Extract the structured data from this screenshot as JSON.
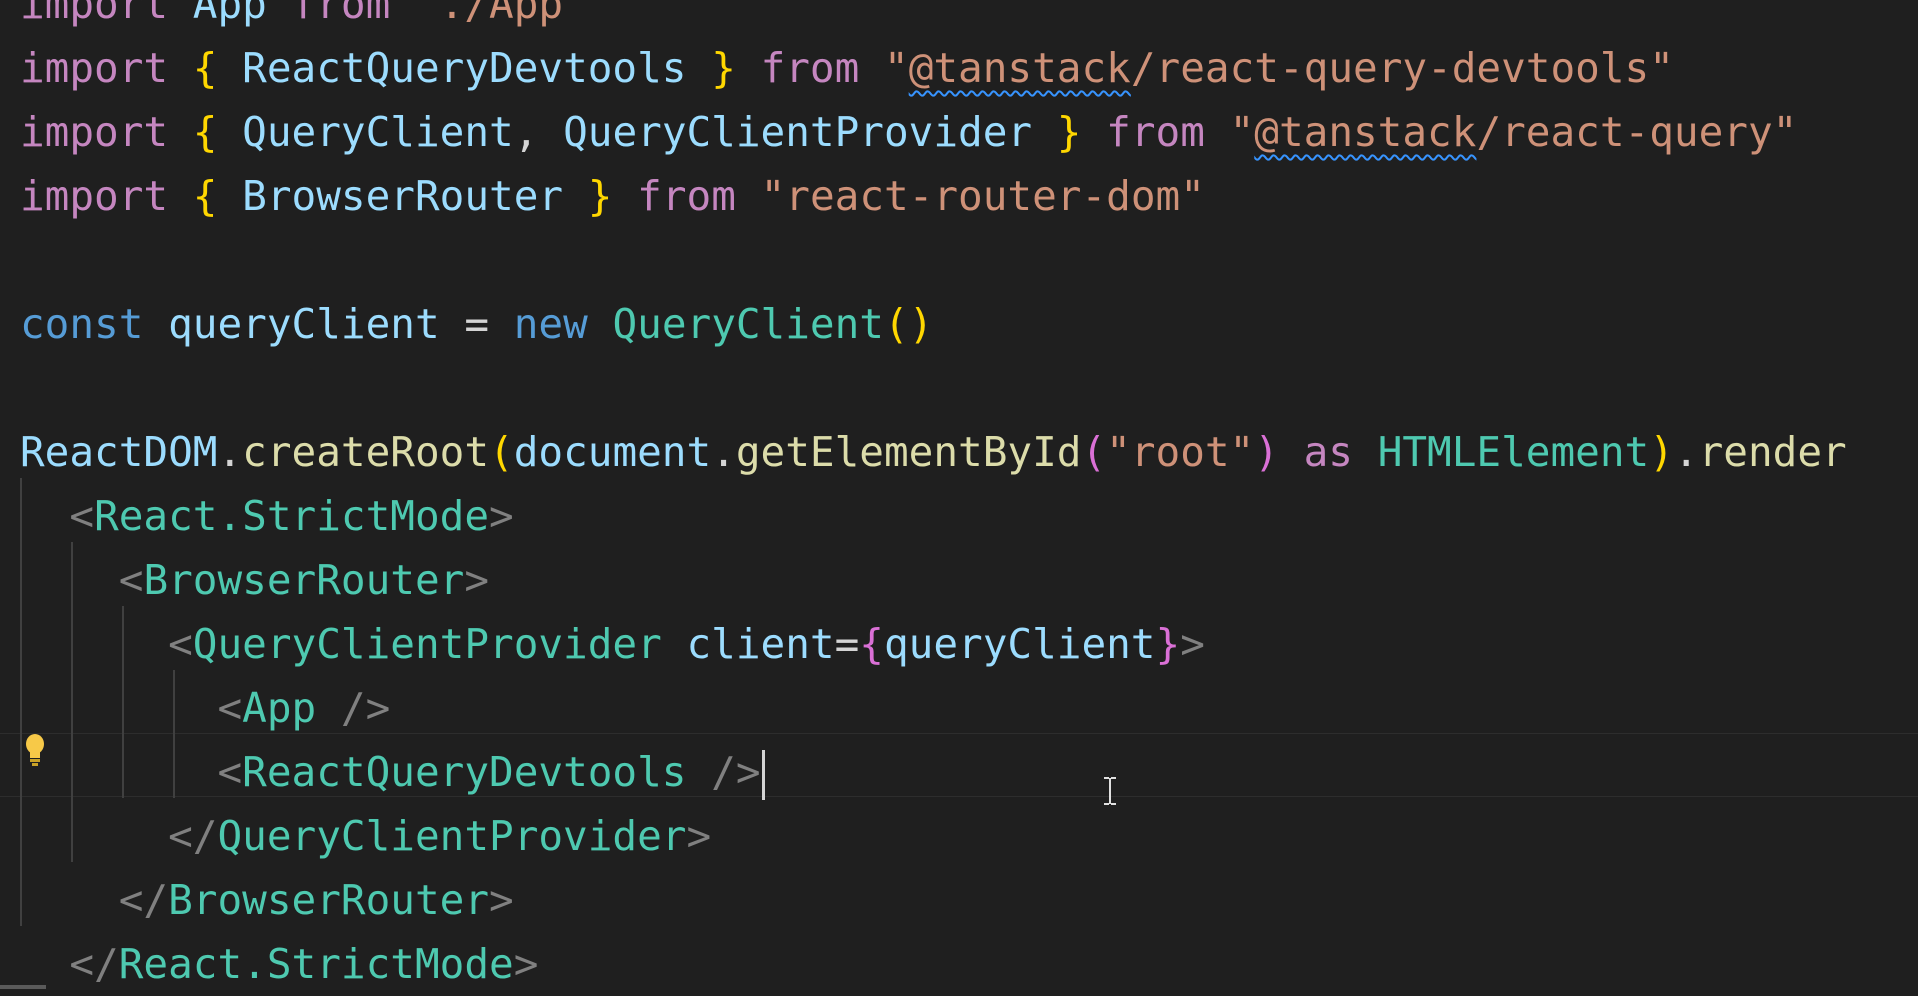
{
  "editor": {
    "language": "TypeScript React",
    "lines": [
      [
        {
          "t": "import",
          "c": "kw"
        },
        {
          "t": " ",
          "c": "pun"
        },
        {
          "t": "App",
          "c": "var"
        },
        {
          "t": " ",
          "c": "pun"
        },
        {
          "t": "from",
          "c": "kw"
        },
        {
          "t": " ",
          "c": "pun"
        },
        {
          "t": "\"./App\"",
          "c": "str"
        }
      ],
      [
        {
          "t": "import",
          "c": "kw"
        },
        {
          "t": " ",
          "c": "pun"
        },
        {
          "t": "{",
          "c": "br"
        },
        {
          "t": " ",
          "c": "pun"
        },
        {
          "t": "ReactQueryDevtools",
          "c": "var"
        },
        {
          "t": " ",
          "c": "pun"
        },
        {
          "t": "}",
          "c": "br"
        },
        {
          "t": " ",
          "c": "pun"
        },
        {
          "t": "from",
          "c": "kw"
        },
        {
          "t": " ",
          "c": "pun"
        },
        {
          "t": "\"",
          "c": "str"
        },
        {
          "t": "@tanstack",
          "c": "str squig"
        },
        {
          "t": "/react-query-devtools\"",
          "c": "str"
        }
      ],
      [
        {
          "t": "import",
          "c": "kw"
        },
        {
          "t": " ",
          "c": "pun"
        },
        {
          "t": "{",
          "c": "br"
        },
        {
          "t": " ",
          "c": "pun"
        },
        {
          "t": "QueryClient",
          "c": "var"
        },
        {
          "t": ", ",
          "c": "pun"
        },
        {
          "t": "QueryClientProvider",
          "c": "var"
        },
        {
          "t": " ",
          "c": "pun"
        },
        {
          "t": "}",
          "c": "br"
        },
        {
          "t": " ",
          "c": "pun"
        },
        {
          "t": "from",
          "c": "kw"
        },
        {
          "t": " ",
          "c": "pun"
        },
        {
          "t": "\"",
          "c": "str"
        },
        {
          "t": "@tanstack",
          "c": "str squig"
        },
        {
          "t": "/react-query\"",
          "c": "str"
        }
      ],
      [
        {
          "t": "import",
          "c": "kw"
        },
        {
          "t": " ",
          "c": "pun"
        },
        {
          "t": "{",
          "c": "br"
        },
        {
          "t": " ",
          "c": "pun"
        },
        {
          "t": "BrowserRouter",
          "c": "var"
        },
        {
          "t": " ",
          "c": "pun"
        },
        {
          "t": "}",
          "c": "br"
        },
        {
          "t": " ",
          "c": "pun"
        },
        {
          "t": "from",
          "c": "kw"
        },
        {
          "t": " ",
          "c": "pun"
        },
        {
          "t": "\"react-router-dom\"",
          "c": "str"
        }
      ],
      [],
      [
        {
          "t": "const",
          "c": "st"
        },
        {
          "t": " ",
          "c": "pun"
        },
        {
          "t": "queryClient",
          "c": "var"
        },
        {
          "t": " = ",
          "c": "pun"
        },
        {
          "t": "new",
          "c": "st"
        },
        {
          "t": " ",
          "c": "pun"
        },
        {
          "t": "QueryClient",
          "c": "ty"
        },
        {
          "t": "()",
          "c": "br"
        }
      ],
      [],
      [
        {
          "t": "ReactDOM",
          "c": "var"
        },
        {
          "t": ".",
          "c": "pun"
        },
        {
          "t": "createRoot",
          "c": "fn"
        },
        {
          "t": "(",
          "c": "br"
        },
        {
          "t": "document",
          "c": "var"
        },
        {
          "t": ".",
          "c": "pun"
        },
        {
          "t": "getElementById",
          "c": "fn"
        },
        {
          "t": "(",
          "c": "br2"
        },
        {
          "t": "\"root\"",
          "c": "str"
        },
        {
          "t": ")",
          "c": "br2"
        },
        {
          "t": " ",
          "c": "pun"
        },
        {
          "t": "as",
          "c": "kw"
        },
        {
          "t": " ",
          "c": "pun"
        },
        {
          "t": "HTMLElement",
          "c": "ty"
        },
        {
          "t": ")",
          "c": "br"
        },
        {
          "t": ".",
          "c": "pun"
        },
        {
          "t": "render",
          "c": "fn"
        }
      ],
      [
        {
          "t": "  ",
          "c": "pun"
        },
        {
          "t": "<",
          "c": "tag"
        },
        {
          "t": "React.StrictMode",
          "c": "jsx"
        },
        {
          "t": ">",
          "c": "tag"
        }
      ],
      [
        {
          "t": "    ",
          "c": "pun"
        },
        {
          "t": "<",
          "c": "tag"
        },
        {
          "t": "BrowserRouter",
          "c": "jsx"
        },
        {
          "t": ">",
          "c": "tag"
        }
      ],
      [
        {
          "t": "      ",
          "c": "pun"
        },
        {
          "t": "<",
          "c": "tag"
        },
        {
          "t": "QueryClientProvider",
          "c": "jsx"
        },
        {
          "t": " ",
          "c": "pun"
        },
        {
          "t": "client",
          "c": "var"
        },
        {
          "t": "=",
          "c": "pun"
        },
        {
          "t": "{",
          "c": "br2"
        },
        {
          "t": "queryClient",
          "c": "var"
        },
        {
          "t": "}",
          "c": "br2"
        },
        {
          "t": ">",
          "c": "tag"
        }
      ],
      [
        {
          "t": "        ",
          "c": "pun"
        },
        {
          "t": "<",
          "c": "tag"
        },
        {
          "t": "App",
          "c": "jsx"
        },
        {
          "t": " />",
          "c": "tag"
        }
      ],
      [
        {
          "t": "        ",
          "c": "pun"
        },
        {
          "t": "<",
          "c": "tag"
        },
        {
          "t": "ReactQueryDevtools",
          "c": "jsx"
        },
        {
          "t": " />",
          "c": "tag"
        }
      ],
      [
        {
          "t": "      ",
          "c": "pun"
        },
        {
          "t": "</",
          "c": "tag"
        },
        {
          "t": "QueryClientProvider",
          "c": "jsx"
        },
        {
          "t": ">",
          "c": "tag"
        }
      ],
      [
        {
          "t": "    ",
          "c": "pun"
        },
        {
          "t": "</",
          "c": "tag"
        },
        {
          "t": "BrowserRouter",
          "c": "jsx"
        },
        {
          "t": ">",
          "c": "tag"
        }
      ],
      [
        {
          "t": "  ",
          "c": "pun"
        },
        {
          "t": "</",
          "c": "tag"
        },
        {
          "t": "React.StrictMode",
          "c": "jsx"
        },
        {
          "t": ">",
          "c": "tag"
        }
      ]
    ],
    "cursor_line": 13,
    "icons": [
      "lightbulb-icon",
      "text-cursor-icon"
    ],
    "colors": {
      "background": "#1f1f1f",
      "keyword": "#c586c0",
      "storage": "#569cd6",
      "variable": "#9cdcfe",
      "function": "#dcdcaa",
      "type": "#4ec9b0",
      "string": "#ce9178",
      "bracket_1": "#ffd700",
      "bracket_2": "#da70d6",
      "tag": "#808080"
    }
  }
}
